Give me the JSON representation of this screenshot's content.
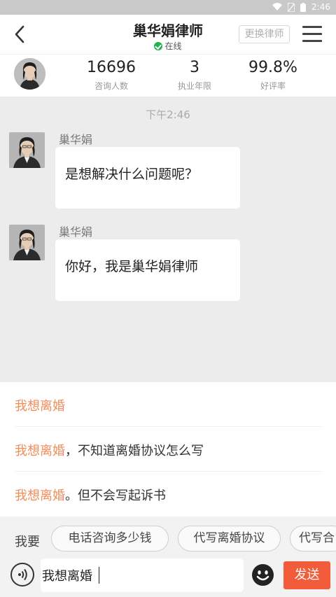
{
  "status_bar": {
    "time": "2:46"
  },
  "header": {
    "title": "巢华娟律师",
    "status": "在线",
    "switch_label": "更换律师"
  },
  "stats": [
    {
      "value": "16696",
      "label": "咨询人数"
    },
    {
      "value": "3",
      "label": "执业年限"
    },
    {
      "value": "99.8%",
      "label": "好评率"
    }
  ],
  "chat": {
    "timestamp": "下午2:46",
    "messages": [
      {
        "sender": "巢华娟",
        "text": "是想解决什么问题呢？"
      },
      {
        "sender": "巢华娟",
        "text": "你好，我是巢华娟律师"
      }
    ]
  },
  "suggestions": [
    {
      "highlight": "我想离婚",
      "rest": ""
    },
    {
      "highlight": "我想离婚",
      "rest": "，不知道离婚协议怎么写"
    },
    {
      "highlight": "我想离婚",
      "rest": "。但不会写起诉书"
    }
  ],
  "quick": {
    "lead": "我要",
    "chips": [
      "电话咨询多少钱",
      "代写离婚协议",
      "代写合"
    ]
  },
  "input": {
    "value": "我想离婚",
    "send_label": "发送"
  },
  "colors": {
    "accent": "#f25c3a",
    "highlight": "#f08d5a",
    "online": "#22b14c"
  }
}
